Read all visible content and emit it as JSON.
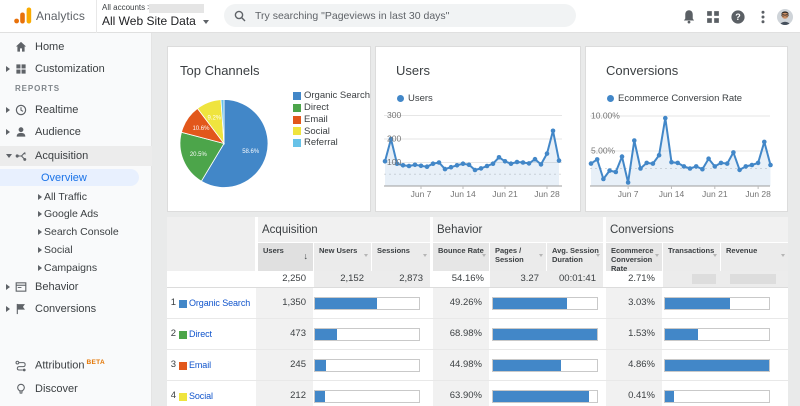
{
  "appbar": {
    "brand": "Analytics",
    "account_label": "All accounts",
    "account_chevron": ">",
    "property_name": "All Web Site Data",
    "search_placeholder": "Try searching \"Pageviews in last 30 days\"",
    "help_glyph": "?"
  },
  "sidebar": {
    "items": [
      {
        "label": "Home"
      },
      {
        "label": "Customization"
      },
      {
        "label": "Realtime"
      },
      {
        "label": "Audience"
      },
      {
        "label": "Acquisition"
      },
      {
        "label": "Overview"
      },
      {
        "label": "All Traffic"
      },
      {
        "label": "Google Ads"
      },
      {
        "label": "Search Console"
      },
      {
        "label": "Social"
      },
      {
        "label": "Campaigns"
      },
      {
        "label": "Behavior"
      },
      {
        "label": "Conversions"
      },
      {
        "label": "Attribution"
      },
      {
        "label": "Discover"
      }
    ],
    "section_label": "REPORTS",
    "attribution_badge": "BETA"
  },
  "chart_data": [
    {
      "id": "top-channels",
      "type": "pie",
      "title": "Top Channels",
      "labels": [
        "Organic Search",
        "Direct",
        "Email",
        "Social",
        "Referral"
      ],
      "values": [
        58.6,
        20.5,
        10.6,
        9.2,
        1.1
      ],
      "slice_labels": [
        "58.6%",
        "20.5%",
        "10.6%",
        "9.2%",
        ""
      ],
      "colors": [
        "#4287c8",
        "#4ca54a",
        "#e2571b",
        "#efe43e",
        "#67c2e8"
      ]
    },
    {
      "id": "users",
      "type": "line",
      "title": "Users",
      "legend": "Users",
      "color": "#4287c8",
      "values": [
        105,
        200,
        95,
        88,
        85,
        90,
        86,
        82,
        95,
        100,
        72,
        80,
        88,
        95,
        90,
        68,
        75,
        85,
        95,
        122,
        105,
        95,
        102,
        100,
        96,
        114,
        92,
        138,
        235,
        108
      ],
      "ylim": [
        0,
        300
      ],
      "yticks": [
        {
          "v": 100,
          "label": "100"
        },
        {
          "v": 200,
          "label": "200"
        },
        {
          "v": 300,
          "label": "300"
        }
      ],
      "xticks": [
        {
          "i": 6,
          "label": "Jun 7"
        },
        {
          "i": 13,
          "label": "Jun 14"
        },
        {
          "i": 20,
          "label": "Jun 21"
        },
        {
          "i": 27,
          "label": "Jun 28"
        }
      ]
    },
    {
      "id": "conversions",
      "type": "line",
      "title": "Conversions",
      "legend": "Ecommerce Conversion Rate",
      "color": "#4287c8",
      "values": [
        3.2,
        3.8,
        1.0,
        2.2,
        2.0,
        4.2,
        0.5,
        6.5,
        2.5,
        3.3,
        3.2,
        4.4,
        9.7,
        3.4,
        3.3,
        2.8,
        2.5,
        2.8,
        2.4,
        3.9,
        2.8,
        3.3,
        3.2,
        4.8,
        2.3,
        2.8,
        3.0,
        3.3,
        6.3,
        3.0
      ],
      "ylim": [
        0,
        10
      ],
      "yticks": [
        {
          "v": 5,
          "label": "5.00%"
        },
        {
          "v": 10,
          "label": "10.00%"
        }
      ],
      "xticks": [
        {
          "i": 6,
          "label": "Jun 7"
        },
        {
          "i": 13,
          "label": "Jun 14"
        },
        {
          "i": 20,
          "label": "Jun 21"
        },
        {
          "i": 27,
          "label": "Jun 28"
        }
      ]
    }
  ],
  "table": {
    "groups": [
      "Acquisition",
      "Behavior",
      "Conversions"
    ],
    "columns": [
      "Users",
      "New Users",
      "Sessions",
      "Bounce Rate",
      "Pages / Session",
      "Avg. Session Duration",
      "Ecommerce Conversion Rate",
      "Transactions",
      "Revenue"
    ],
    "totals": {
      "users": "2,250",
      "new_users": "2,152",
      "sessions": "2,873",
      "bounce_rate": "54.16%",
      "pages_session": "3.27",
      "avg_duration": "00:01:41",
      "conv_rate": "2.71%"
    },
    "rows": [
      {
        "rank": "1",
        "channel": "Organic Search",
        "color": "#4287c8",
        "users": "1,350",
        "users_bar": 59.2,
        "bounce": "49.26%",
        "bounce_bar": 71.4,
        "conv": "3.03%",
        "conv_bar": 62.3
      },
      {
        "rank": "2",
        "channel": "Direct",
        "color": "#4ca54a",
        "users": "473",
        "users_bar": 20.7,
        "bounce": "68.98%",
        "bounce_bar": 100,
        "conv": "1.53%",
        "conv_bar": 31.5
      },
      {
        "rank": "3",
        "channel": "Email",
        "color": "#e2571b",
        "users": "245",
        "users_bar": 10.7,
        "bounce": "44.98%",
        "bounce_bar": 65.2,
        "conv": "4.86%",
        "conv_bar": 100
      },
      {
        "rank": "4",
        "channel": "Social",
        "color": "#efe43e",
        "users": "212",
        "users_bar": 9.3,
        "bounce": "63.90%",
        "bounce_bar": 92.6,
        "conv": "0.41%",
        "conv_bar": 8.4
      }
    ]
  }
}
